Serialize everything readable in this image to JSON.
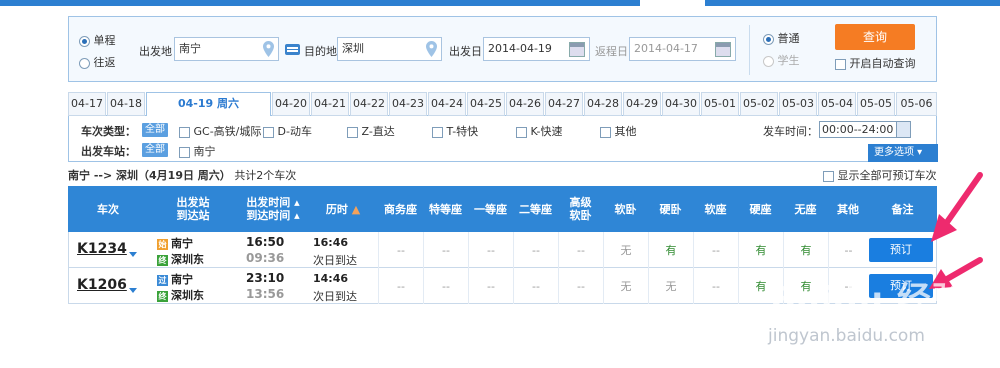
{
  "trip": {
    "oneway": "单程",
    "roundtrip": "往返"
  },
  "from_label": "出发地",
  "from_value": "南宁",
  "to_label": "目的地",
  "to_value": "深圳",
  "depart_label": "出发日",
  "depart_value": "2014-04-19",
  "return_label": "返程日",
  "return_value": "2014-04-17",
  "ticket": {
    "normal": "普通",
    "student": "学生"
  },
  "query_button": "查询",
  "auto_query": "开启自动查询",
  "dates": [
    "04-17",
    "04-18",
    "04-19 周六",
    "04-20",
    "04-21",
    "04-22",
    "04-23",
    "04-24",
    "04-25",
    "04-26",
    "04-27",
    "04-28",
    "04-29",
    "04-30",
    "05-01",
    "05-02",
    "05-03",
    "05-04",
    "05-05",
    "05-06"
  ],
  "filter": {
    "type_label": "车次类型：",
    "all": "全部",
    "types": [
      "GC-高铁/城际",
      "D-动车",
      "Z-直达",
      "T-特快",
      "K-快速",
      "其他"
    ],
    "station_label": "出发车站：",
    "stations": [
      "南宁"
    ],
    "time_label": "发车时间：",
    "time_value": "00:00--24:00",
    "more": "更多选项"
  },
  "summary": {
    "route": "南宁 --> 深圳（4月19日  周六）",
    "count": "共计2个车次"
  },
  "show_all": "显示全部可预订车次",
  "columns": {
    "train": "车次",
    "stations_top": "出发站",
    "stations_bottom": "到达站",
    "time_top": "出发时间",
    "time_bottom": "到达时间",
    "duration": "历时",
    "seats": [
      "商务座",
      "特等座",
      "一等座",
      "二等座",
      "高级\n软卧",
      "软卧",
      "硬卧",
      "软座",
      "硬座",
      "无座",
      "其他"
    ],
    "note": "备注"
  },
  "trains": [
    {
      "no": "K1234",
      "from": "南宁",
      "from_tag": "始",
      "to": "深圳东",
      "to_tag": "终",
      "dep": "16:50",
      "arr": "09:36",
      "dur": "16:46",
      "dur_note": "次日到达",
      "seats": [
        "--",
        "--",
        "--",
        "--",
        "--",
        "无",
        "有",
        "--",
        "有",
        "有",
        "--"
      ],
      "book": "预订"
    },
    {
      "no": "K1206",
      "from": "南宁",
      "from_tag": "过",
      "to": "深圳东",
      "to_tag": "终",
      "dep": "23:10",
      "arr": "13:56",
      "dur": "14:46",
      "dur_note": "次日到达",
      "seats": [
        "--",
        "--",
        "--",
        "--",
        "--",
        "无",
        "无",
        "--",
        "有",
        "有",
        "--"
      ],
      "book": "预订"
    }
  ],
  "watermark": {
    "line1": "Baidu 经验",
    "line2": "jingyan.baidu.com"
  },
  "colors": {
    "accent": "#2f86d6",
    "query": "#f57c23",
    "available": "#2f8a2f",
    "arrow": "#ee2a6e"
  }
}
